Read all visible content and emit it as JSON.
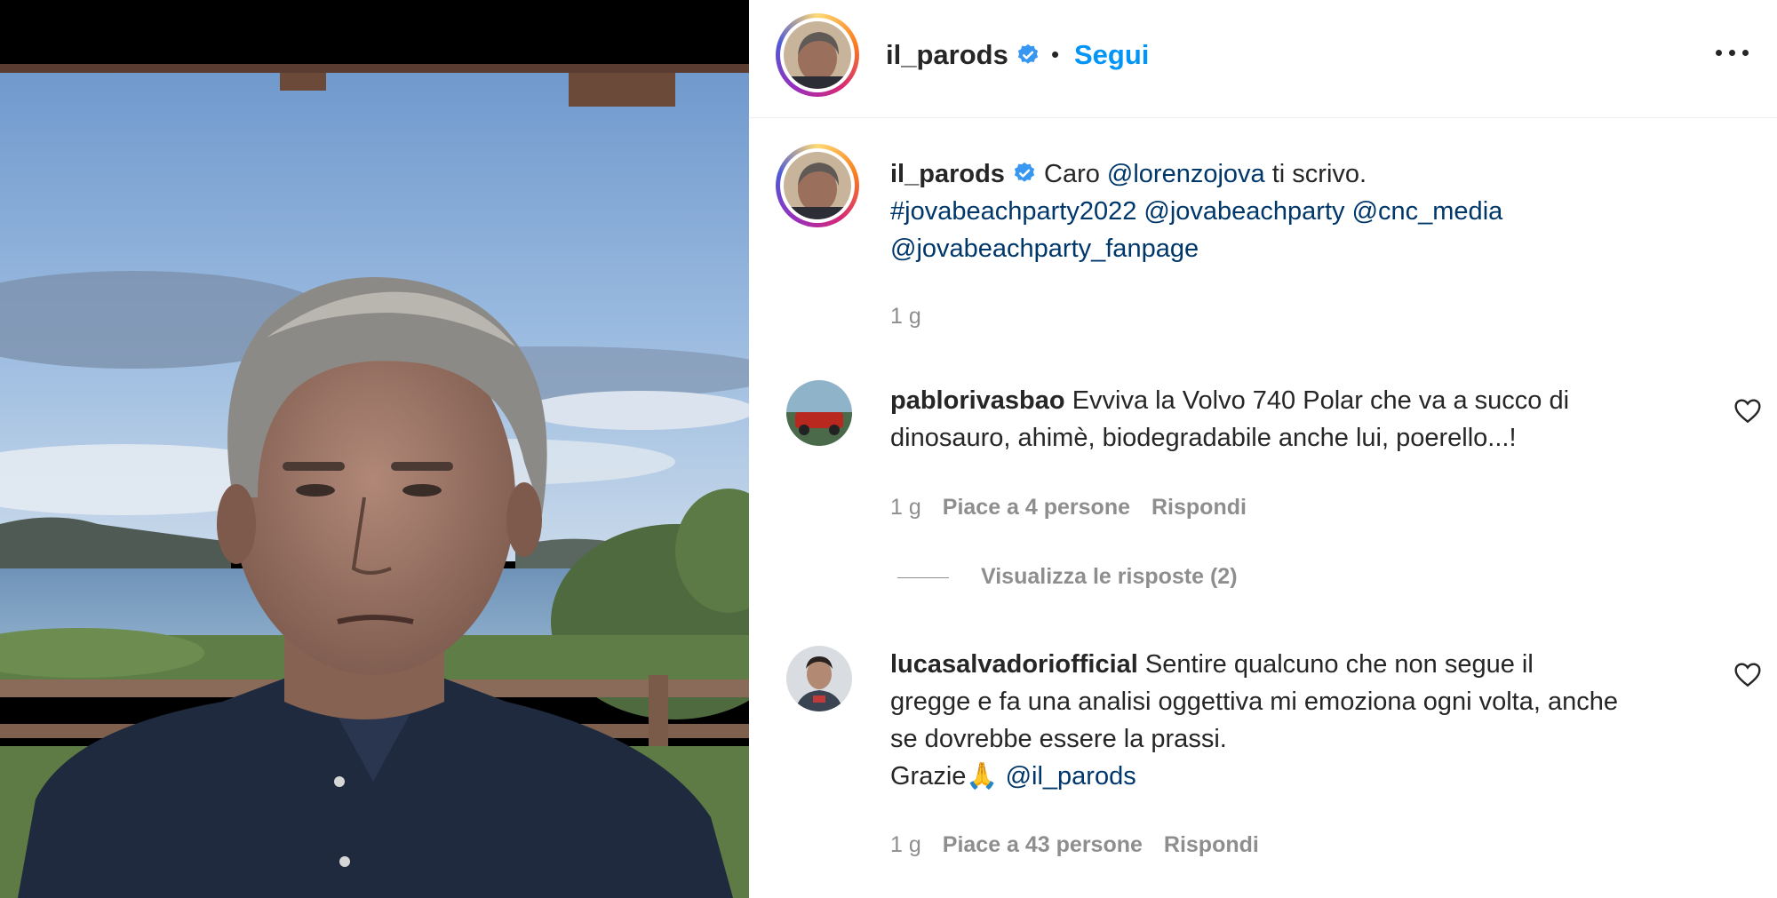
{
  "post": {
    "username": "il_parods",
    "separator": "•",
    "follow_label": "Segui",
    "more_icon": "more-horizontal-icon"
  },
  "caption": {
    "username": "il_parods",
    "text_prefix": "Caro ",
    "mention_1": "@lorenzojova",
    "text_mid": " ti scrivo.",
    "hashtag": "#jovabeachparty2022",
    "mention_2": "@jovabeachparty",
    "mention_3": "@cnc_media",
    "mention_4": "@jovabeachparty_fanpage",
    "time": "1 g"
  },
  "comments": [
    {
      "username": "pablorivasbao",
      "text": "Evviva la Volvo 740 Polar che va a succo di dinosauro, ahimè, biodegradabile anche lui, poerello...!",
      "time": "1 g",
      "likes": "Piace a 4 persone",
      "reply": "Rispondi",
      "view_replies": "Visualizza le risposte (2)"
    },
    {
      "username": "lucasalvadoriofficial",
      "text_line": "Sentire qualcuno che non segue il gregge e fa una analisi oggettiva mi emoziona ogni volta, anche se dovrebbe essere la prassi.",
      "text_thanks": "Grazie🙏",
      "mention": "@il_parods",
      "time": "1 g",
      "likes": "Piace a 43 persone",
      "reply": "Rispondi"
    }
  ],
  "colors": {
    "link": "#00376b",
    "follow": "#0095f6",
    "secondary": "#8e8e8e",
    "verified": "#3897f0"
  }
}
